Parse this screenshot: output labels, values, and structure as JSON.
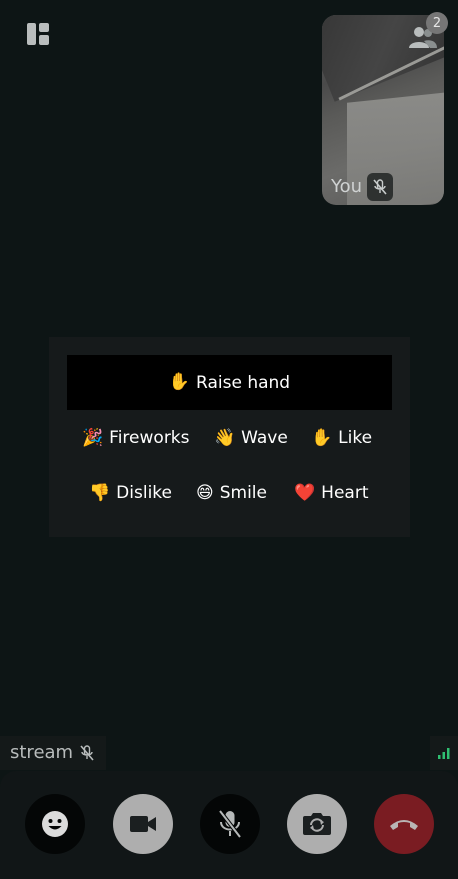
{
  "header": {
    "layout_icon": "layout-grid-icon",
    "participants_icon": "participants-icon",
    "participants_count": "2"
  },
  "self_view": {
    "label": "You",
    "mic_icon": "mic-off-icon"
  },
  "reactions": {
    "raise_hand": {
      "emoji": "✋",
      "label": "Raise hand"
    },
    "items": [
      {
        "emoji": "🎉",
        "label": "Fireworks"
      },
      {
        "emoji": "👋",
        "label": "Wave"
      },
      {
        "emoji": "✋",
        "label": "Like"
      },
      {
        "emoji": "👎",
        "label": "Dislike"
      },
      {
        "emoji": "😄",
        "label": "Smile"
      },
      {
        "emoji": "❤️",
        "label": "Heart"
      }
    ]
  },
  "stream": {
    "label": "stream",
    "mic_icon": "mic-off-icon",
    "signal_icon": "signal-bars-icon"
  },
  "controls": {
    "buttons": [
      {
        "name": "reactions-button",
        "icon": "smile-icon"
      },
      {
        "name": "camera-button",
        "icon": "video-camera-icon"
      },
      {
        "name": "microphone-button",
        "icon": "mic-off-icon"
      },
      {
        "name": "switch-camera-button",
        "icon": "camera-switch-icon"
      },
      {
        "name": "hang-up-button",
        "icon": "phone-hangup-icon"
      }
    ]
  },
  "colors": {
    "background": "#0d1515",
    "panel": "#161a1b",
    "hang_up": "#7a1c22",
    "control_light": "#aeaeae",
    "signal": "#2fbf71"
  }
}
